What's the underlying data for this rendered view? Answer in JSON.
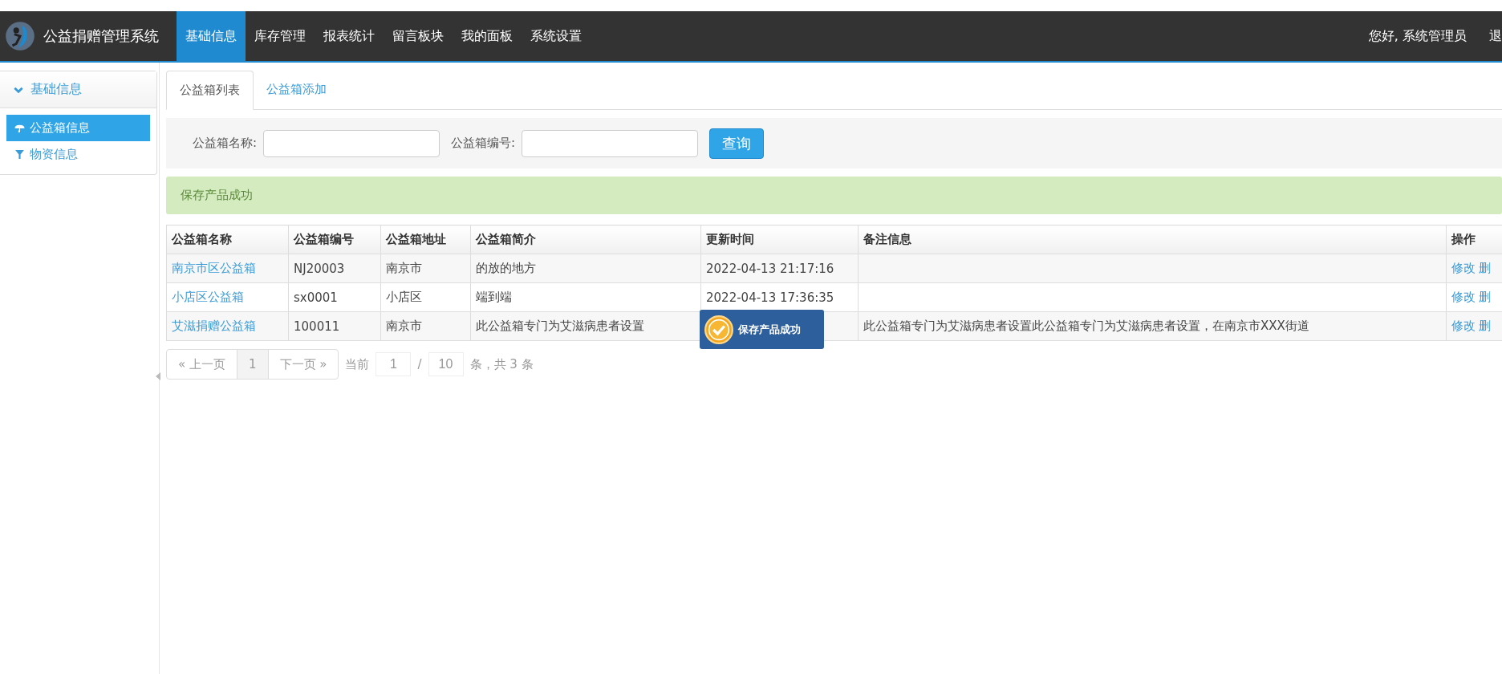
{
  "navbar": {
    "title": "公益捐赠管理系统",
    "menu": [
      {
        "label": "基础信息",
        "selected": true
      },
      {
        "label": "库存管理",
        "selected": false
      },
      {
        "label": "报表统计",
        "selected": false
      },
      {
        "label": "留言板块",
        "selected": false
      },
      {
        "label": "我的面板",
        "selected": false
      },
      {
        "label": "系统设置",
        "selected": false
      }
    ],
    "greeting": "您好, 系统管理员",
    "logout": "退"
  },
  "sidebar": {
    "heading": "基础信息",
    "expanded": true,
    "items": [
      {
        "label": "公益箱信息",
        "kind": "umbrella",
        "selected": true
      },
      {
        "label": "物资信息",
        "kind": "filter",
        "selected": false
      }
    ]
  },
  "tabs": [
    {
      "label": "公益箱列表",
      "selected": true
    },
    {
      "label": "公益箱添加",
      "selected": false
    }
  ],
  "search": {
    "fields": [
      {
        "label": "公益箱名称:"
      },
      {
        "label": "公益箱编号:"
      }
    ],
    "button": "查询"
  },
  "alert": "保存产品成功",
  "table": {
    "columns": [
      "公益箱名称",
      "公益箱编号",
      "公益箱地址",
      "公益箱简介",
      "更新时间",
      "备注信息",
      "操作"
    ],
    "rows": [
      {
        "name": "南京市区公益箱",
        "code": "NJ20003",
        "address": "南京市",
        "intro": "的放的地方",
        "time": "2022-04-13 21:17:16",
        "actions": [
          "修改",
          "删"
        ]
      },
      {
        "name": "小店区公益箱",
        "code": "sx0001",
        "address": "小店区",
        "intro": "端到端",
        "time": "2022-04-13 17:36:35",
        "actions": [
          "修改",
          "删"
        ]
      },
      {
        "name": "艾滋捐赠公益箱",
        "code": "100011",
        "address": "南京市",
        "intro": "此公益箱专门为艾滋病患者设置",
        "note": "此公益箱专门为艾滋病患者设置此公益箱专门为艾滋病患者设置，在南京市XXX街道",
        "actions": [
          "修改",
          "删"
        ]
      }
    ]
  },
  "pagination": {
    "prev": "« 上一页",
    "pages": [
      {
        "label": "1",
        "selected": true
      }
    ],
    "next": "下一页 »",
    "current_label": "当前",
    "current": "1",
    "separator": "/",
    "page_size": "10",
    "summary": "条，共 3 条"
  },
  "toast": "保存产品成功"
}
